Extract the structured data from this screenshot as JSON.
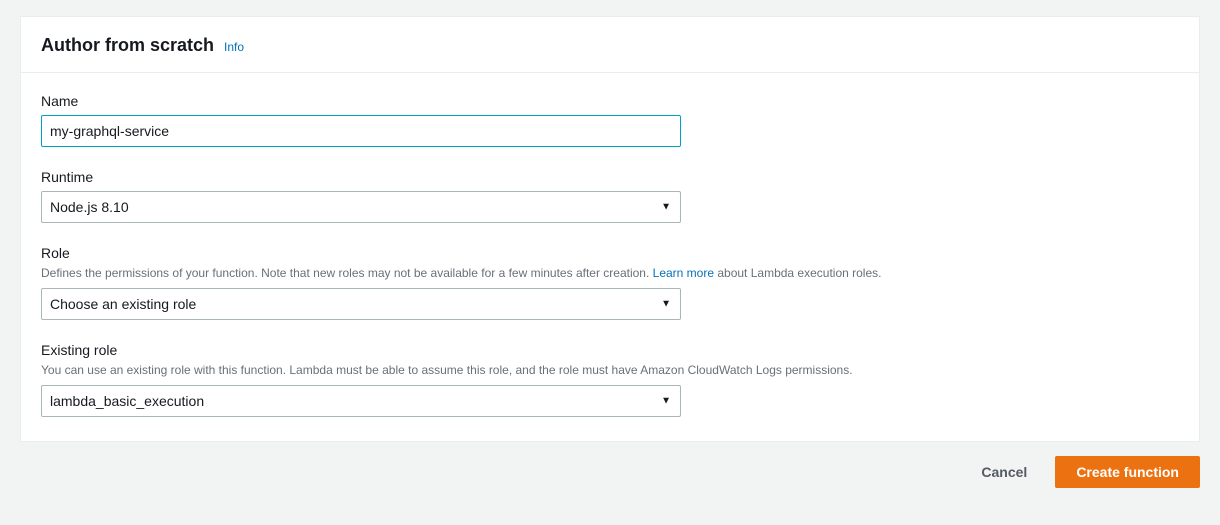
{
  "header": {
    "title": "Author from scratch",
    "info_label": "Info"
  },
  "form": {
    "name": {
      "label": "Name",
      "value": "my-graphql-service"
    },
    "runtime": {
      "label": "Runtime",
      "selected": "Node.js 8.10"
    },
    "role": {
      "label": "Role",
      "hint_before": "Defines the permissions of your function. Note that new roles may not be available for a few minutes after creation. ",
      "learn_more": "Learn more",
      "hint_after": " about Lambda execution roles.",
      "selected": "Choose an existing role"
    },
    "existing_role": {
      "label": "Existing role",
      "hint": "You can use an existing role with this function. Lambda must be able to assume this role, and the role must have Amazon CloudWatch Logs permissions.",
      "selected": "lambda_basic_execution"
    }
  },
  "footer": {
    "cancel": "Cancel",
    "create": "Create function"
  }
}
